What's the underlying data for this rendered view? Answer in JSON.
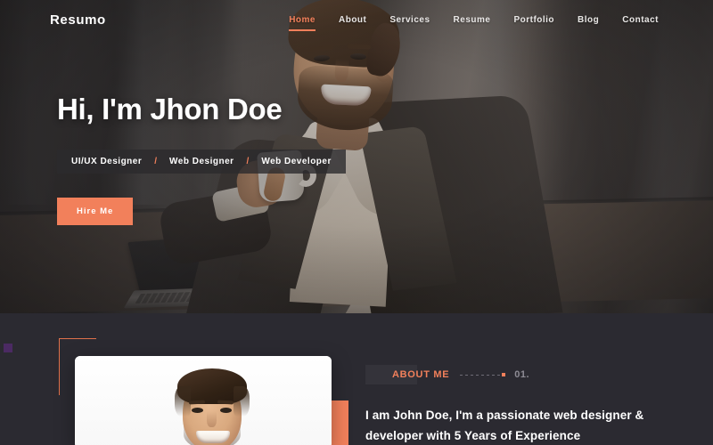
{
  "site": {
    "logo": "Resumo"
  },
  "nav": {
    "items": [
      {
        "label": "Home",
        "active": true
      },
      {
        "label": "About",
        "active": false
      },
      {
        "label": "Services",
        "active": false
      },
      {
        "label": "Resume",
        "active": false
      },
      {
        "label": "Portfolio",
        "active": false
      },
      {
        "label": "Blog",
        "active": false
      },
      {
        "label": "Contact",
        "active": false
      }
    ]
  },
  "hero": {
    "title": "Hi, I'm Jhon Doe",
    "roles": [
      "UI/UX Designer",
      "Web Designer",
      "Web Developer"
    ],
    "separator": "/",
    "cta_label": "Hire Me"
  },
  "about": {
    "label": "ABOUT ME",
    "number": "01.",
    "headline": "I am John Doe, I'm a passionate web designer & developer with 5 Years of Experience",
    "photo_alt": "portrait-photo"
  },
  "colors": {
    "accent": "#f2805b",
    "dark_section": "#2b2a31",
    "label_backdrop": "#34333a",
    "purple_marker": "#4b2a63",
    "nav_text": "#e9e7e6",
    "muted_text": "#8d8b94"
  }
}
